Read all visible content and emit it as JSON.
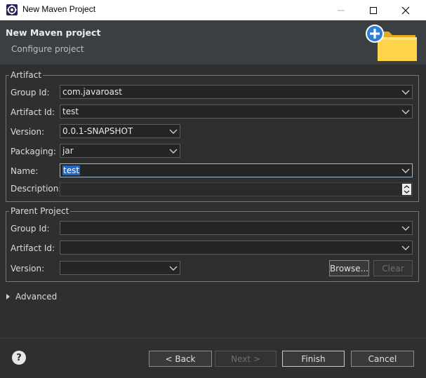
{
  "window": {
    "title": "New Maven Project",
    "minimize_icon": "minimize-icon",
    "maximize_icon": "maximize-icon",
    "close_icon": "close-icon"
  },
  "header": {
    "title": "New Maven project",
    "subtitle": "Configure project",
    "icon": "new-folder-wizard-icon"
  },
  "artifact": {
    "legend": "Artifact",
    "group_id_label": "Group Id:",
    "group_id_value": "com.javaroast",
    "artifact_id_label": "Artifact Id:",
    "artifact_id_value": "test",
    "version_label": "Version:",
    "version_value": "0.0.1-SNAPSHOT",
    "packaging_label": "Packaging:",
    "packaging_value": "jar",
    "name_label": "Name:",
    "name_value": "test",
    "description_label": "Description:",
    "description_value": ""
  },
  "parent": {
    "legend": "Parent Project",
    "group_id_label": "Group Id:",
    "group_id_value": "",
    "artifact_id_label": "Artifact Id:",
    "artifact_id_value": "",
    "version_label": "Version:",
    "version_value": "",
    "browse_label": "Browse...",
    "clear_label": "Clear"
  },
  "advanced": {
    "label": "Advanced",
    "icon": "expand-triangle-icon"
  },
  "footer": {
    "help_icon": "help-icon",
    "back_label": "< Back",
    "next_label": "Next >",
    "finish_label": "Finish",
    "cancel_label": "Cancel"
  },
  "colors": {
    "dialog_bg": "#2f2f2f",
    "header_bg": "#3c3f41",
    "selection": "#2366c8",
    "field_bg": "#252525"
  }
}
